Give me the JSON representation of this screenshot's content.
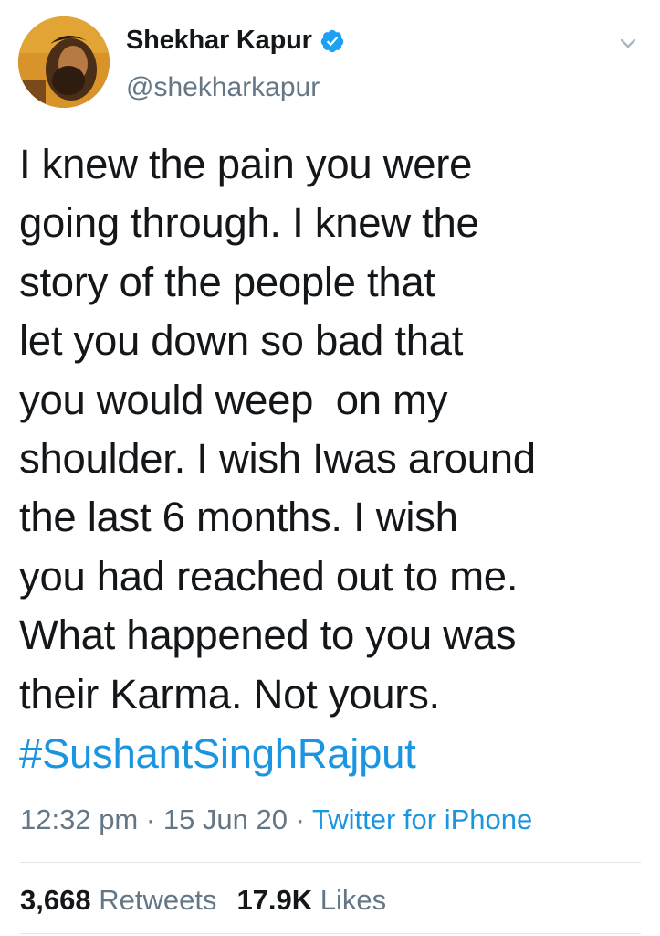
{
  "author": {
    "display_name": "Shekhar Kapur",
    "handle": "@shekharkapur",
    "verified": true
  },
  "tweet": {
    "lines": [
      "I knew the pain you were",
      "going through. I knew the",
      "story of the people that",
      "let you down so bad that",
      "you would weep  on my",
      "shoulder. I wish Iwas around",
      "the last 6 months. I wish",
      "you had reached out to me.",
      "What happened to you was",
      "their Karma. Not yours."
    ],
    "hashtag": "#SushantSinghRajput"
  },
  "meta": {
    "time": "12:32 pm",
    "separator": "·",
    "date": "15 Jun 20",
    "source": "Twitter for iPhone"
  },
  "stats": {
    "retweets_count": "3,668",
    "retweets_label": "Retweets",
    "likes_count": "17.9K",
    "likes_label": "Likes"
  },
  "colors": {
    "link": "#1b95e0",
    "secondary": "#657786",
    "primary_text": "#14171a",
    "divider": "#e1e8ed"
  },
  "icons": {
    "verified": "verified-badge-icon",
    "more": "chevron-down-icon"
  }
}
